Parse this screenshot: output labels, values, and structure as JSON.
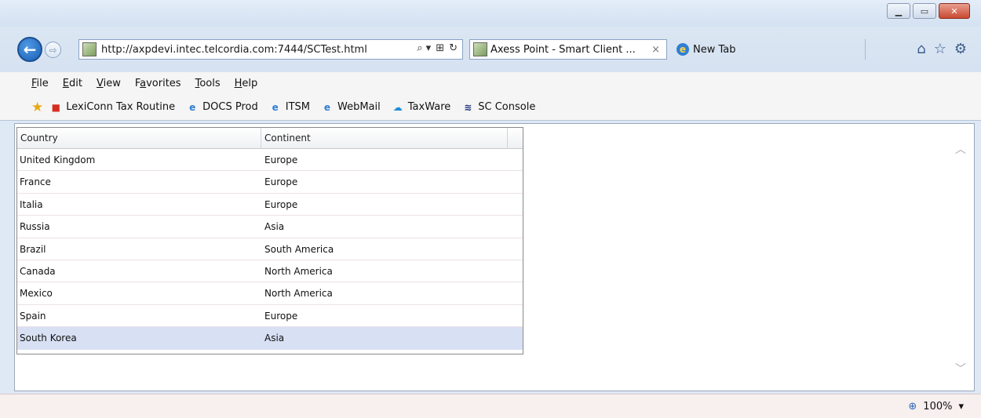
{
  "browser": {
    "url": "http://axpdevi.intec.telcordia.com:7444/SCTest.html",
    "address_tools": [
      "⌕ ▾",
      "⊞",
      "↻"
    ],
    "tabs": [
      {
        "label": "Axess Point - Smart Client ...",
        "active": true,
        "close": "×"
      },
      {
        "label": "New Tab",
        "active": false
      }
    ],
    "window_buttons": {
      "minimize": "▁",
      "maximize": "▭",
      "close": "✕"
    },
    "right_tools": [
      "⌂",
      "☆",
      "⚙"
    ]
  },
  "menu": {
    "items": [
      {
        "label": "File",
        "accel": "F",
        "rest": "ile"
      },
      {
        "label": "Edit",
        "accel": "E",
        "rest": "dit"
      },
      {
        "label": "View",
        "accel": "V",
        "rest": "iew"
      },
      {
        "label": "Favorites",
        "accel": "a",
        "pre": "F",
        "rest": "vorites"
      },
      {
        "label": "Tools",
        "accel": "T",
        "rest": "ools"
      },
      {
        "label": "Help",
        "accel": "H",
        "rest": "elp"
      }
    ]
  },
  "favorites": {
    "items": [
      {
        "label": "LexiConn Tax Routine",
        "icon": "lexiconn-icon"
      },
      {
        "label": "DOCS Prod",
        "icon": "ie-icon"
      },
      {
        "label": "ITSM",
        "icon": "ie-icon"
      },
      {
        "label": "WebMail",
        "icon": "ie-icon"
      },
      {
        "label": "TaxWare",
        "icon": "cloud-icon"
      },
      {
        "label": "SC Console",
        "icon": "sc-icon"
      }
    ]
  },
  "grid": {
    "columns": [
      "Country",
      "Continent"
    ],
    "rows": [
      [
        "United Kingdom",
        "Europe"
      ],
      [
        "France",
        "Europe"
      ],
      [
        "Italia",
        "Europe"
      ],
      [
        "Russia",
        "Asia"
      ],
      [
        "Brazil",
        "South America"
      ],
      [
        "Canada",
        "North America"
      ],
      [
        "Mexico",
        "North America"
      ],
      [
        "Spain",
        "Europe"
      ],
      [
        "South Korea",
        "Asia"
      ]
    ],
    "selected_row": 8
  },
  "status": {
    "zoom": "100%"
  }
}
